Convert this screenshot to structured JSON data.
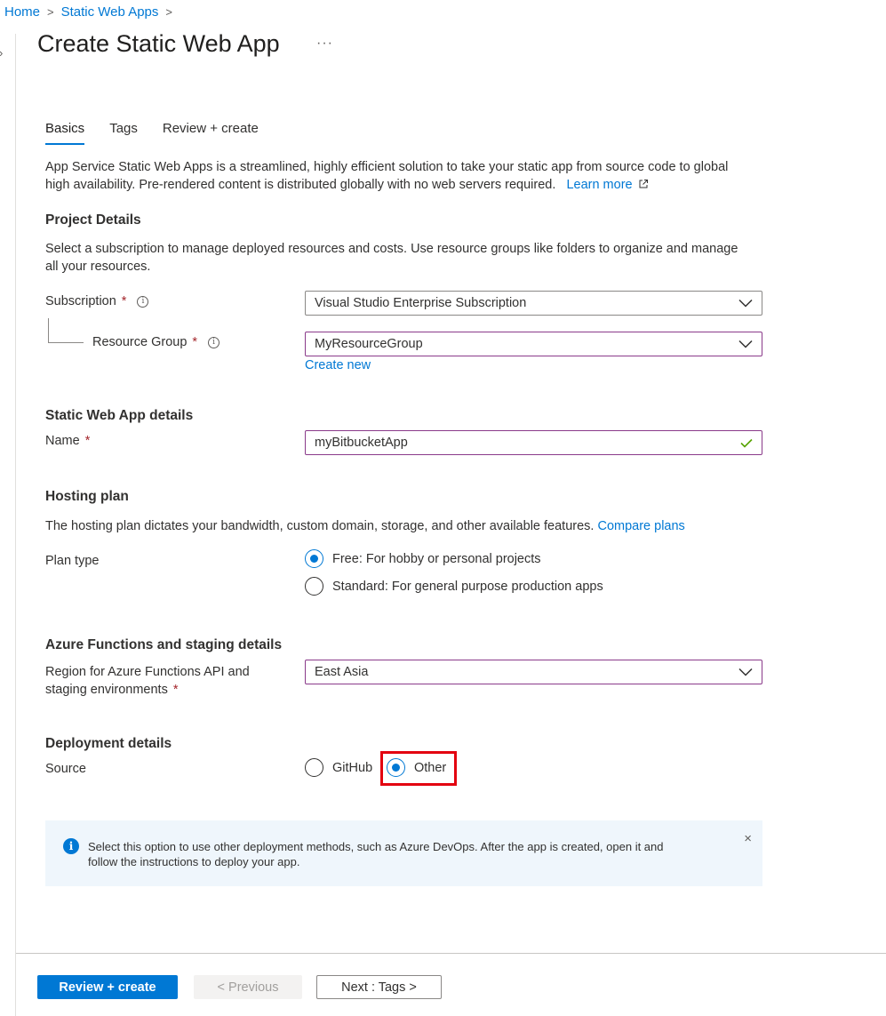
{
  "breadcrumb": {
    "home": "Home",
    "parent": "Static Web Apps",
    "sep": ">"
  },
  "page": {
    "title": "Create Static Web App",
    "more": "···"
  },
  "tabs": [
    {
      "label": "Basics",
      "active": true
    },
    {
      "label": "Tags",
      "active": false
    },
    {
      "label": "Review + create",
      "active": false
    }
  ],
  "intro": {
    "line1": "App Service Static Web Apps is a streamlined, highly efficient solution to take your static app from source code to global",
    "line2": "high availability. Pre-rendered content is distributed globally with no web servers required.",
    "learn_more": "Learn more"
  },
  "project": {
    "heading": "Project Details",
    "desc1": "Select a subscription to manage deployed resources and costs. Use resource groups like folders to organize and manage",
    "desc2": "all your resources.",
    "subscription_label": "Subscription",
    "subscription_value": "Visual Studio Enterprise Subscription",
    "rg_label": "Resource Group",
    "rg_value": "MyResourceGroup",
    "create_new": "Create new",
    "required_mark": "*",
    "info_glyph": "i"
  },
  "details": {
    "heading": "Static Web App details",
    "name_label": "Name",
    "name_value": "myBitbucketApp",
    "valid": true
  },
  "hosting": {
    "heading": "Hosting plan",
    "desc": "The hosting plan dictates your bandwidth, custom domain, storage, and other available features.",
    "compare": "Compare plans",
    "plan_label": "Plan type",
    "options": [
      {
        "label": "Free: For hobby or personal projects",
        "selected": true
      },
      {
        "label": "Standard: For general purpose production apps",
        "selected": false
      }
    ]
  },
  "functions": {
    "heading": "Azure Functions and staging details",
    "region_label1": "Region for Azure Functions API and",
    "region_label2": "staging environments",
    "region_value": "East Asia"
  },
  "deployment": {
    "heading": "Deployment details",
    "source_label": "Source",
    "options": [
      {
        "label": "GitHub",
        "selected": false
      },
      {
        "label": "Other",
        "selected": true
      }
    ],
    "highlight_color": "#e3000f"
  },
  "infobar": {
    "line1": "Select this option to use other deployment methods, such as Azure DevOps. After the app is created, open it and",
    "line2": "follow the instructions to deploy your app.",
    "close": "×",
    "icon_glyph": "i"
  },
  "footer": {
    "review": "Review + create",
    "previous": "< Previous",
    "next": "Next : Tags >"
  },
  "colors": {
    "accent": "#0078d4",
    "required": "#a4262c",
    "valid": "#57a300",
    "focus_border": "#8a3a8a"
  }
}
